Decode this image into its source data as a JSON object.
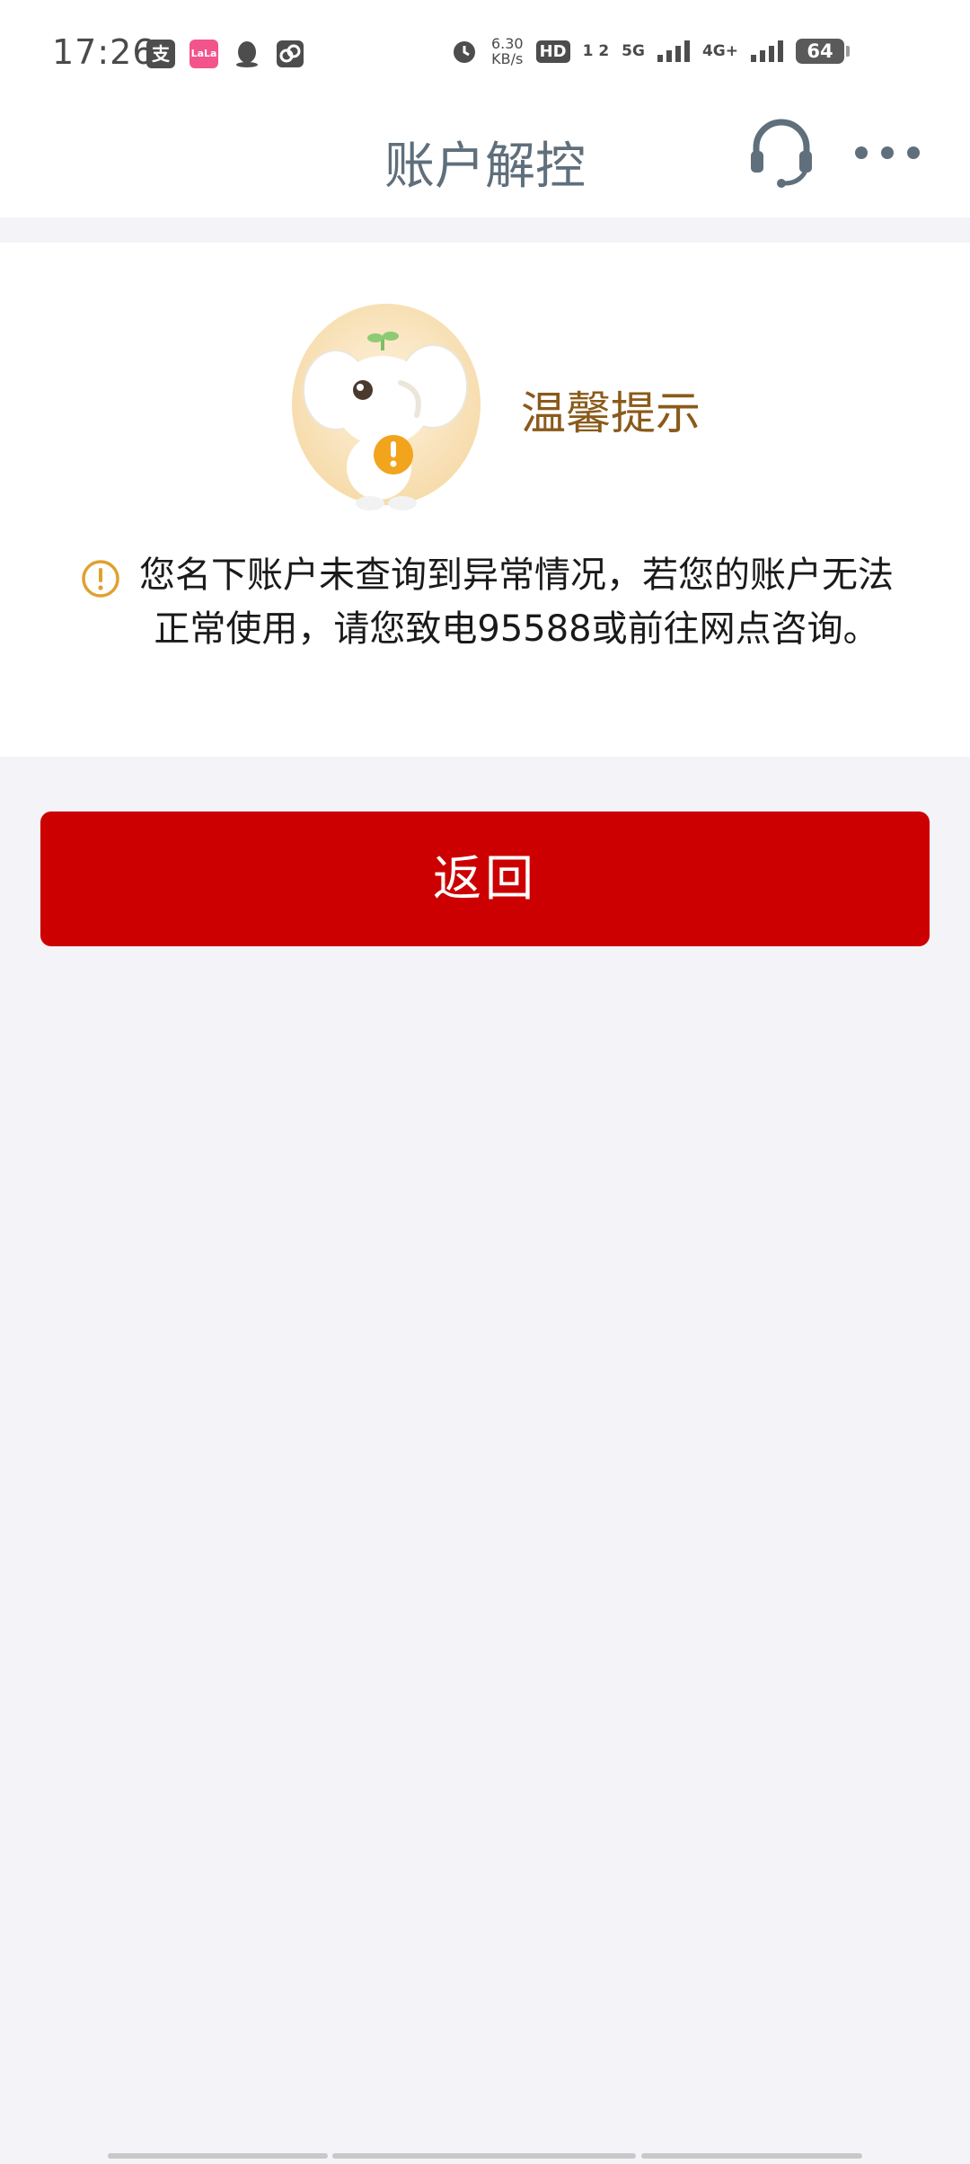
{
  "status_bar": {
    "time": "17:26",
    "app_icons": [
      "支",
      "LaLa"
    ],
    "net_speed_value": "6.30",
    "net_speed_unit": "KB/s",
    "hd": "HD",
    "sim_slots": "1 2",
    "network_5g": "5G",
    "network_4g": "4G+",
    "battery": "64"
  },
  "nav": {
    "title": "账户解控"
  },
  "card": {
    "tip_title": "温馨提示",
    "message": "您名下账户未查询到异常情况，若您的账户无法正常使用，请您致电95588或前往网点咨询。"
  },
  "actions": {
    "return_label": "返回"
  },
  "colors": {
    "accent_red": "#cc0000",
    "tip_brown": "#8a5a1a",
    "nav_gray": "#5f6f7b",
    "warning_orange": "#e0a030"
  }
}
